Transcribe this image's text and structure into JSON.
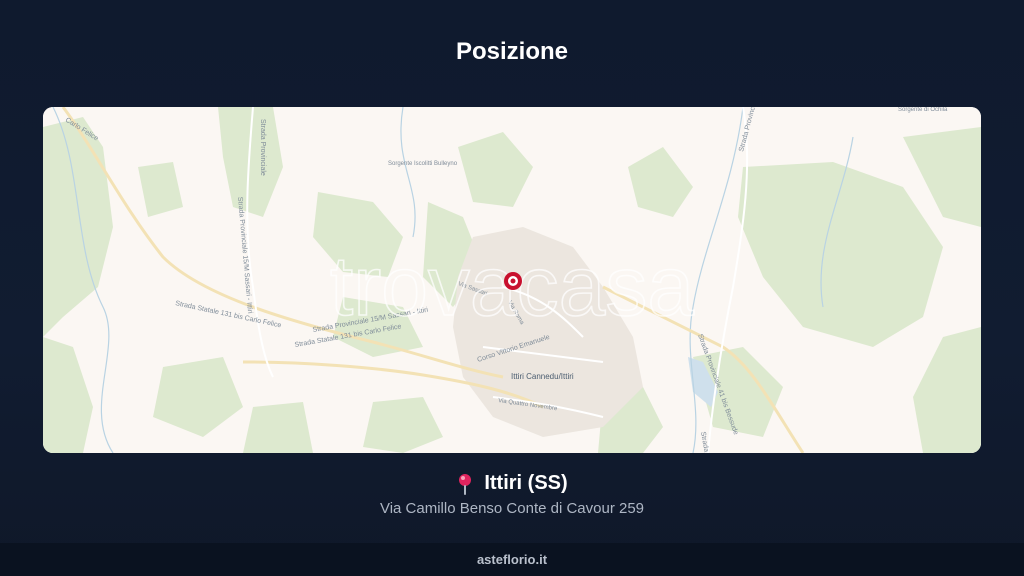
{
  "header": {
    "title": "Posizione"
  },
  "map": {
    "watermark": "trovacasa",
    "marker_icon": "location-target-icon",
    "labels": {
      "town": "Ittiri Cannedu/Ittiri",
      "corso": "Corso Vittorio Emanuele",
      "quattro_novembre": "Via Quattro Novembre",
      "via_sassari": "Via Sassari",
      "via_roma": "Via Roma",
      "ss131_upper": "Strada Statale 131 bis Carlo Felice",
      "ss131_lower": "Strada Statale 131 bis Carlo Felice",
      "sp15_sassari": "Strada Provinciale 15/M Sassari - Ittiri",
      "sp15_lower": "Strada Provinciale 15/M Sassari - Ittiri",
      "sp_left_vertical": "Strada Provinciale",
      "carlo_felice_corner": "Carlo Felice",
      "sorgente_bulleyno": "Sorgente Iscolitti Bulleyno",
      "sorgente_right": "Sorgente di Ochila",
      "sp_right": "Strada Provinciale",
      "sp_right_lower": "Strada Provinciale 41 bis Bessude",
      "sp_bottom_right": "Strada"
    },
    "colors": {
      "land": "#fbf7f3",
      "green": "#dfedd3",
      "marker": "#c8102e"
    }
  },
  "location": {
    "pin_icon": "map-pin-icon",
    "name": "Ittiri (SS)",
    "address": "Via Camillo Benso Conte di Cavour 259"
  },
  "footer": {
    "site": "asteflorio.it"
  }
}
